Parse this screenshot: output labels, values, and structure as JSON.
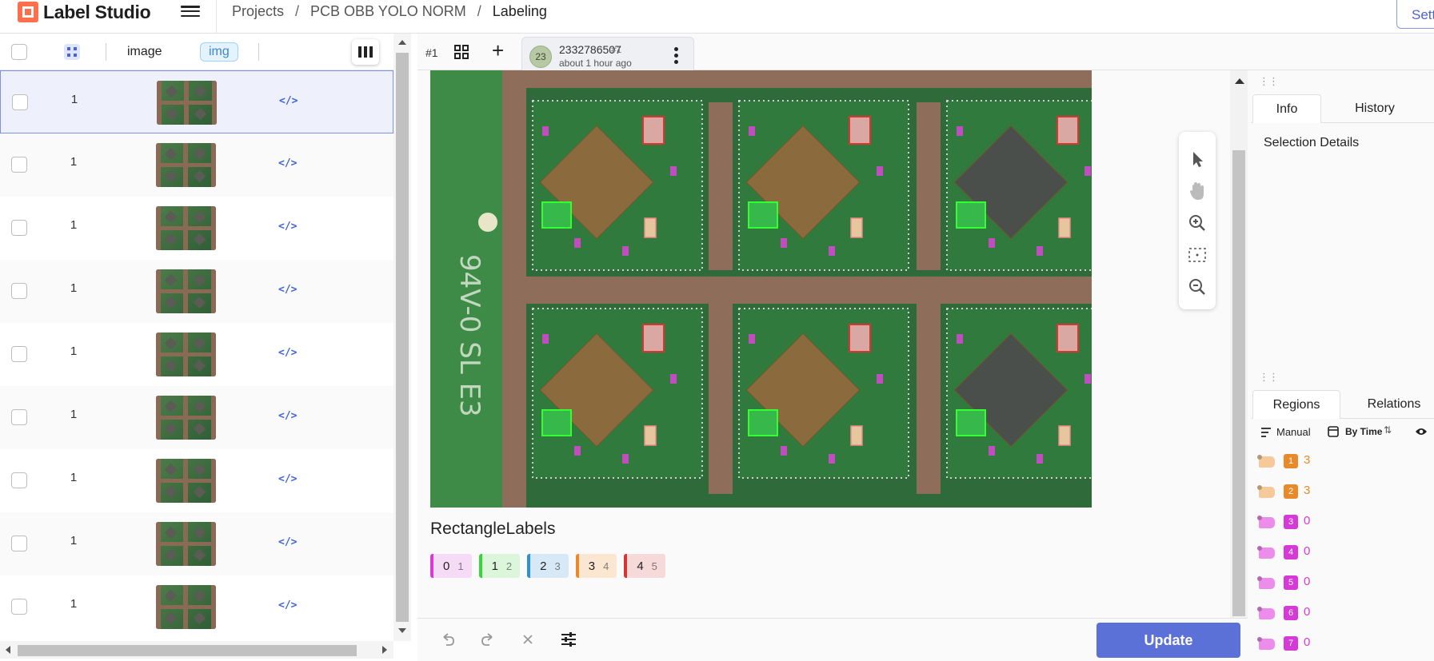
{
  "app": {
    "name": "Label Studio"
  },
  "breadcrumb": {
    "projects": "Projects",
    "sep": "/",
    "project": "PCB OBB YOLO NORM",
    "page": "Labeling"
  },
  "header": {
    "settings_label": "Sett"
  },
  "table": {
    "columns": {
      "image": "image",
      "img_tag": "img"
    },
    "rows": [
      {
        "num": "1",
        "selected": true
      },
      {
        "num": "1"
      },
      {
        "num": "1"
      },
      {
        "num": "1"
      },
      {
        "num": "1"
      },
      {
        "num": "1"
      },
      {
        "num": "1"
      },
      {
        "num": "1"
      },
      {
        "num": "1"
      }
    ],
    "code_icon": "</>"
  },
  "annotation_tabs": {
    "task_num": "#1",
    "annotation": {
      "avatar": "23",
      "id": "2332786507",
      "sub": "#1",
      "time": "about 1 hour ago"
    }
  },
  "labeling": {
    "title": "RectangleLabels",
    "labels": [
      {
        "name": "0",
        "hotkey": "1",
        "color": "#d63ad6",
        "bg": "#f6dbf6"
      },
      {
        "name": "1",
        "hotkey": "2",
        "color": "#35d635",
        "bg": "#dbf6db"
      },
      {
        "name": "2",
        "hotkey": "3",
        "color": "#2f8fd8",
        "bg": "#d7e9f7"
      },
      {
        "name": "3",
        "hotkey": "4",
        "color": "#e98a2a",
        "bg": "#fbe6d2"
      },
      {
        "name": "4",
        "hotkey": "5",
        "color": "#d63535",
        "bg": "#f6dada"
      }
    ]
  },
  "bottom": {
    "update_label": "Update"
  },
  "info_panel": {
    "tab_info": "Info",
    "tab_history": "History",
    "selection_details": "Selection Details"
  },
  "regions_panel": {
    "tab_regions": "Regions",
    "tab_relations": "Relations",
    "sort_manual": "Manual",
    "sort_by_time": "By Time",
    "regions": [
      {
        "badge": "1",
        "text": "3",
        "color": "#e98a2a",
        "flag": "#f6c99b"
      },
      {
        "badge": "2",
        "text": "3",
        "color": "#e98a2a",
        "flag": "#f6c99b"
      },
      {
        "badge": "3",
        "text": "0",
        "color": "#d63ad6",
        "flag": "#ec8dec"
      },
      {
        "badge": "4",
        "text": "0",
        "color": "#d63ad6",
        "flag": "#ec8dec"
      },
      {
        "badge": "5",
        "text": "0",
        "color": "#d63ad6",
        "flag": "#ec8dec"
      },
      {
        "badge": "6",
        "text": "0",
        "color": "#d63ad6",
        "flag": "#ec8dec"
      },
      {
        "badge": "7",
        "text": "0",
        "color": "#d63ad6",
        "flag": "#ec8dec"
      }
    ]
  }
}
